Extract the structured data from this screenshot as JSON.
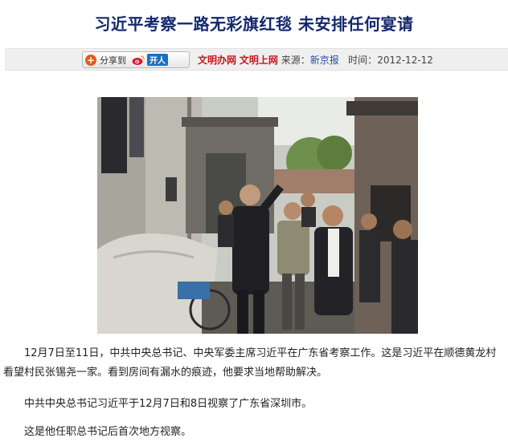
{
  "article": {
    "title": "习近平考察一路无彩旗红毯 未安排任何宴请",
    "paragraphs": [
      "12月7日至11日，中共中央总书记、中央军委主席习近平在广东省考察工作。这是习近平在顺德黄龙村看望村民张锡尧一家。看到房间有漏水的痕迹，他要求当地帮助解决。",
      "中共中央总书记习近平于12月7日和8日视察了广东省深圳市。",
      "这是他任职总书记后首次地方视察。"
    ]
  },
  "share": {
    "label": "分享到",
    "plus_glyph": "+",
    "renren_label": "开人",
    "icons": [
      "plus-circle-icon",
      "weibo-icon",
      "renren-icon"
    ]
  },
  "meta": {
    "site1": "文明办网",
    "site2": "文明上网",
    "source_label": "来源：",
    "source": "新京报",
    "time_label": "时间：",
    "time": "2012-12-12"
  },
  "colors": {
    "title": "#14286e",
    "red_link": "#c8161d",
    "blue_link": "#1f4fa8",
    "bar_bg": "#efefef"
  }
}
